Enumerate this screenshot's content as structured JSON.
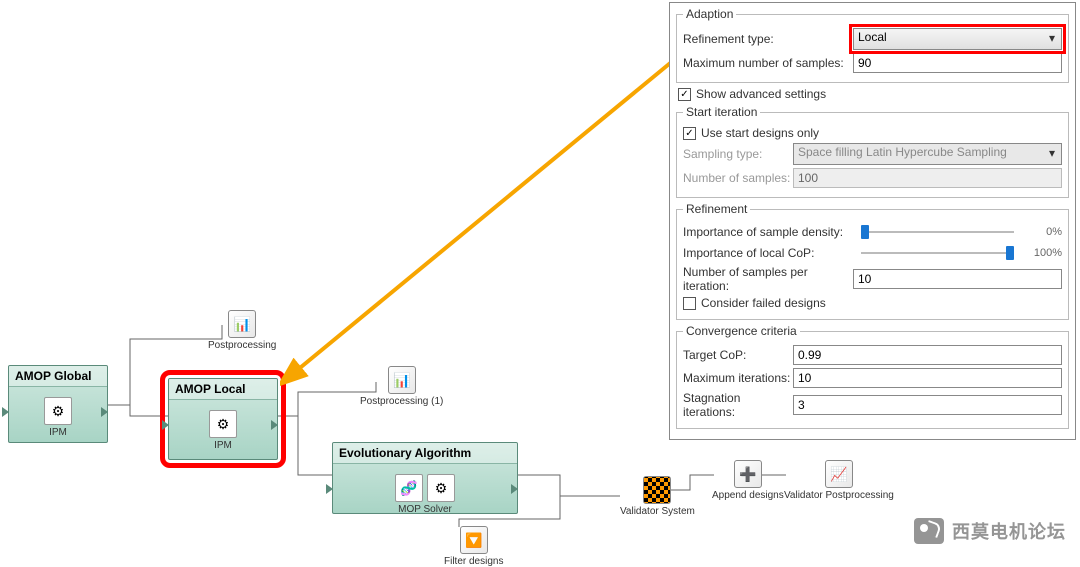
{
  "workflow": {
    "amop_global": {
      "title": "AMOP Global",
      "sub": "IPM"
    },
    "amop_local": {
      "title": "AMOP Local",
      "sub": "IPM"
    },
    "ea": {
      "title": "Evolutionary Algorithm",
      "sub": "MOP Solver"
    },
    "tools": {
      "postproc": "Postprocessing",
      "postproc1": "Postprocessing (1)",
      "validator_system": "Validator System",
      "append_designs": "Append designs",
      "validator_postproc": "Validator Postprocessing",
      "filter_designs": "Filter designs"
    }
  },
  "panel": {
    "adaption_legend": "Adaption",
    "refinement_type_label": "Refinement type:",
    "refinement_type_value": "Local",
    "max_samples_label": "Maximum number of samples:",
    "max_samples_value": "90",
    "show_advanced_label": "Show advanced settings",
    "start_iteration_legend": "Start iteration",
    "use_start_label": "Use start designs only",
    "sampling_type_label": "Sampling type:",
    "sampling_type_value": "Space filling Latin Hypercube Sampling",
    "num_samples_label": "Number of samples:",
    "num_samples_value": "100",
    "refinement_legend": "Refinement",
    "imp_density_label": "Importance of sample density:",
    "imp_density_value": "0%",
    "imp_cop_label": "Importance of local CoP:",
    "imp_cop_value": "100%",
    "num_per_iter_label": "Number of samples per iteration:",
    "num_per_iter_value": "10",
    "consider_failed_label": "Consider failed designs",
    "convergence_legend": "Convergence criteria",
    "target_cop_label": "Target CoP:",
    "target_cop_value": "0.99",
    "max_iter_label": "Maximum iterations:",
    "max_iter_value": "10",
    "stag_iter_label": "Stagnation iterations:",
    "stag_iter_value": "3"
  },
  "watermark": "西莫电机论坛",
  "chart_data": {
    "type": "diagram",
    "description": "Workflow graph linking AMOP Global → AMOP Local → Evolutionary Algorithm with auxiliary postprocessing, validator and filter nodes. Settings panel highlights Refinement type = Local (red box) and an orange callout arrow from the panel to the AMOP Local node (red box).",
    "nodes": [
      {
        "id": "amop_global",
        "label": "AMOP Global",
        "sub": "IPM"
      },
      {
        "id": "amop_local",
        "label": "AMOP Local",
        "sub": "IPM",
        "highlight": true
      },
      {
        "id": "ea",
        "label": "Evolutionary Algorithm",
        "sub": "MOP Solver"
      },
      {
        "id": "postproc",
        "label": "Postprocessing",
        "kind": "tool"
      },
      {
        "id": "postproc1",
        "label": "Postprocessing (1)",
        "kind": "tool"
      },
      {
        "id": "validator_system",
        "label": "Validator System",
        "kind": "tool"
      },
      {
        "id": "append_designs",
        "label": "Append designs",
        "kind": "tool"
      },
      {
        "id": "validator_postproc",
        "label": "Validator Postprocessing",
        "kind": "tool"
      },
      {
        "id": "filter_designs",
        "label": "Filter designs",
        "kind": "tool"
      }
    ],
    "edges": [
      [
        "amop_global",
        "postproc"
      ],
      [
        "amop_global",
        "amop_local"
      ],
      [
        "amop_local",
        "postproc1"
      ],
      [
        "amop_local",
        "ea"
      ],
      [
        "ea",
        "validator_system"
      ],
      [
        "ea",
        "filter_designs"
      ],
      [
        "validator_system",
        "append_designs"
      ],
      [
        "append_designs",
        "validator_postproc"
      ]
    ]
  }
}
